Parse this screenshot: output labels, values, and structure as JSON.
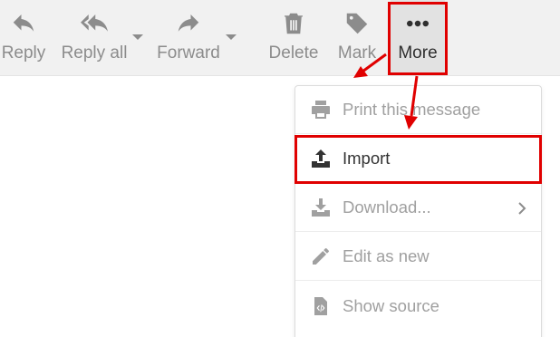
{
  "toolbar": {
    "reply_label": "Reply",
    "reply_all_label": "Reply all",
    "forward_label": "Forward",
    "delete_label": "Delete",
    "mark_label": "Mark",
    "more_label": "More"
  },
  "icons": {
    "reply": "reply-icon",
    "reply_all": "reply-all-icon",
    "forward": "forward-icon",
    "delete": "trash-icon",
    "mark": "tag-icon",
    "more": "ellipsis-icon",
    "print": "printer-icon",
    "import": "upload-icon",
    "download": "download-icon",
    "edit": "pencil-icon",
    "source": "code-file-icon"
  },
  "menu": {
    "items": [
      {
        "label": "Print this message",
        "enabled": false
      },
      {
        "label": "Import",
        "enabled": true
      },
      {
        "label": "Download...",
        "enabled": false
      },
      {
        "label": "Edit as new",
        "enabled": false
      },
      {
        "label": "Show source",
        "enabled": false
      }
    ]
  },
  "colors": {
    "toolbar_bg": "#f1f1f1",
    "toolbar_text": "#8c8c8c",
    "active_text": "#2f2f2f",
    "highlight": "#e00000",
    "disabled_text": "#a0a0a0"
  }
}
